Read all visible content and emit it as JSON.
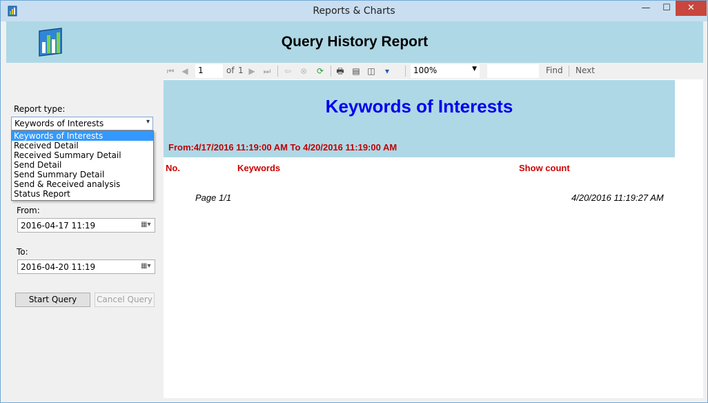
{
  "window": {
    "title": "Reports & Charts",
    "minimize_glyph": "—",
    "maximize_glyph": "☐",
    "close_glyph": "✕"
  },
  "header": {
    "title": "Query History Report",
    "logo_icon": "bar-chart-icon"
  },
  "sidebar": {
    "report_type_label": "Report type:",
    "report_type_value": "Keywords of Interests",
    "report_type_options": [
      "Keywords of Interests",
      "Received Detail",
      "Received Summary Detail",
      "Send Detail",
      "Send Summary Detail",
      "Send & Received analysis",
      "Status Report"
    ],
    "from_label": "From:",
    "from_value": "2016-04-17 11:19",
    "to_label": "To:",
    "to_value": "2016-04-20 11:19",
    "start_button": "Start Query",
    "cancel_button": "Cancel Query"
  },
  "toolbar": {
    "page_current": "1",
    "page_of": "of",
    "page_total": "1",
    "zoom": "100%",
    "find_value": "",
    "find_label": "Find",
    "next_label": "Next"
  },
  "report": {
    "title": "Keywords of Interests",
    "range": "From:4/17/2016 11:19:00 AM To 4/20/2016 11:19:00 AM",
    "columns": [
      "No.",
      "Keywords",
      "Show count"
    ],
    "page_label": "Page 1/1",
    "generated": "4/20/2016 11:19:27 AM"
  },
  "colors": {
    "banner": "#aed8e6",
    "title_blue": "#0000ee",
    "accent_red": "#cc0000",
    "selection": "#3399ff"
  }
}
